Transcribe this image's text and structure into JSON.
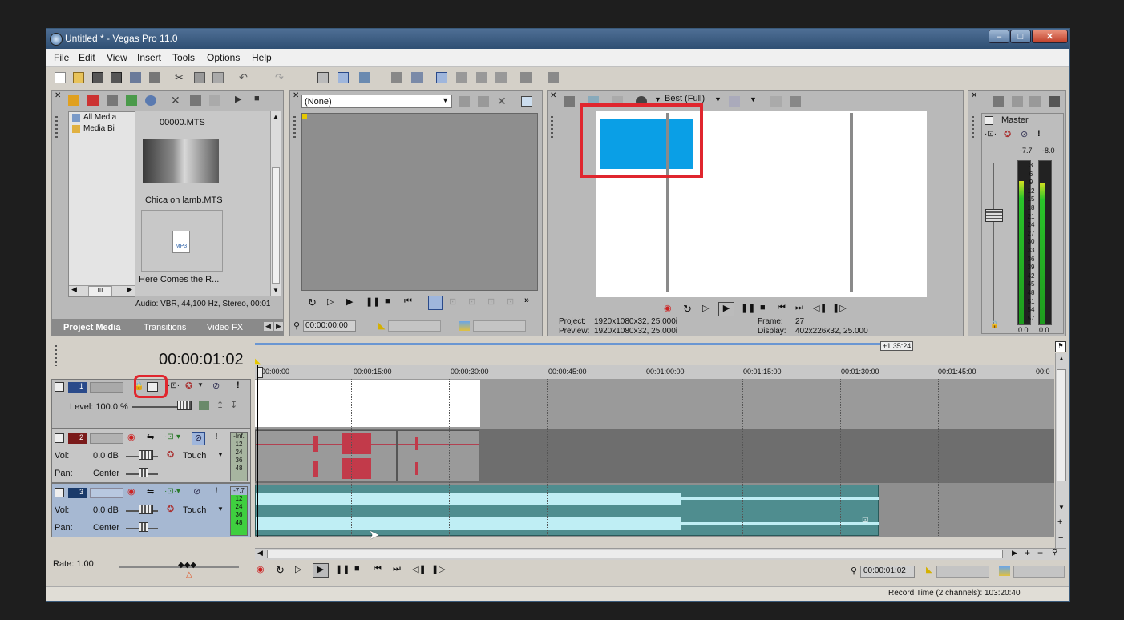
{
  "window": {
    "title": "Untitled * - Vegas Pro 11.0"
  },
  "menu": [
    "File",
    "Edit",
    "View",
    "Insert",
    "Tools",
    "Options",
    "Help"
  ],
  "explorer": {
    "tree": [
      "All Media",
      "Media Bi"
    ],
    "files": [
      "00000.MTS",
      "Chica on lamb.MTS",
      "Here Comes the R..."
    ],
    "mp3_label": "MP3",
    "info": "Audio: VBR, 44,100 Hz, Stereo, 00:01",
    "tabs": [
      "Project Media",
      "Transitions",
      "Video FX"
    ],
    "scroll_thumb": "III"
  },
  "trimmer": {
    "dropdown": "(None)",
    "time": "00:00:00:00"
  },
  "preview": {
    "quality": "Best (Full)",
    "project_label": "Project:",
    "project_value": "1920x1080x32, 25.000i",
    "preview_label": "Preview:",
    "preview_value": "1920x1080x32, 25.000i",
    "frame_label": "Frame:",
    "frame_value": "27",
    "display_label": "Display:",
    "display_value": "402x226x32, 25.000"
  },
  "master": {
    "label": "Master",
    "peak_left": "-7.7",
    "peak_right": "-8.0",
    "scale": [
      "3",
      "6",
      "9",
      "12",
      "15",
      "18",
      "21",
      "24",
      "27",
      "30",
      "33",
      "36",
      "39",
      "42",
      "45",
      "48",
      "51",
      "54",
      "57"
    ],
    "bottom_left": "0.0",
    "bottom_right": "0.0"
  },
  "timeline": {
    "time": "00:00:01:02",
    "end_marker": "+1:35:24",
    "ruler": [
      "00:00:00",
      "00:00:15:00",
      "00:00:30:00",
      "00:00:45:00",
      "00:01:00:00",
      "00:01:15:00",
      "00:01:30:00",
      "00:01:45:00",
      "00:0"
    ],
    "tracks": [
      {
        "number": "1",
        "level": "Level: 100.0 %"
      },
      {
        "number": "2",
        "vol_label": "Vol:",
        "vol": "0.0 dB",
        "pan_label": "Pan:",
        "pan": "Center",
        "mode": "Touch",
        "meter_top": "-Inf.",
        "meter_scale": [
          "12",
          "24",
          "36",
          "48"
        ]
      },
      {
        "number": "3",
        "vol_label": "Vol:",
        "vol": "0.0 dB",
        "pan_label": "Pan:",
        "pan": "Center",
        "mode": "Touch",
        "meter_top": "-7.7",
        "meter_scale": [
          "12",
          "24",
          "36",
          "48"
        ]
      }
    ],
    "rate": "Rate: 1.00",
    "cursor_time": "00:00:01:02"
  },
  "status": "Record Time (2 channels): 103:20:40",
  "colors": {
    "highlight": "#e0262e",
    "preview_box": "#0a9fe6",
    "audio_track2": "#c23a4a",
    "audio_track3": "#bfeef4"
  }
}
